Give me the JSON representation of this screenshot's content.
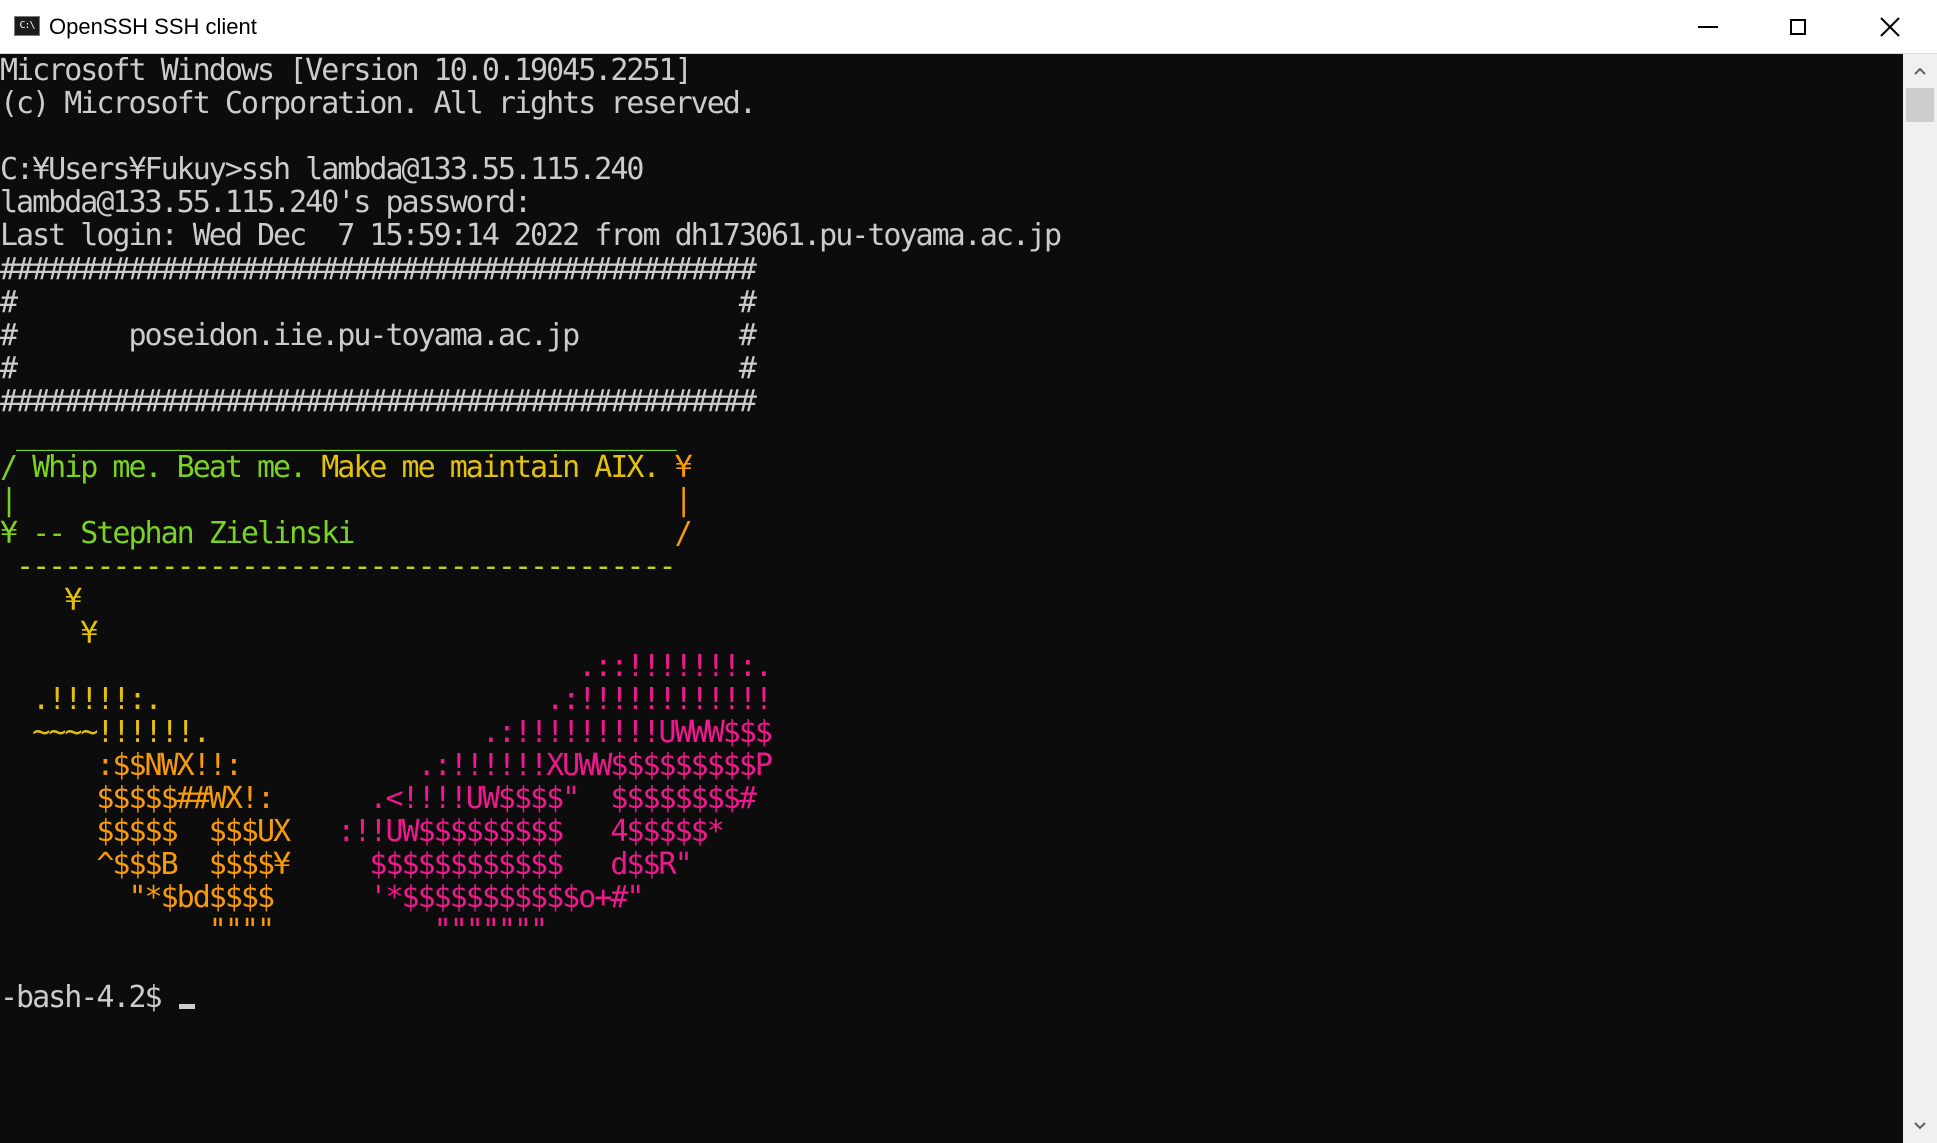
{
  "window": {
    "title": "OpenSSH SSH client",
    "icon_name": "console-app-icon",
    "icon_text": "C:\\",
    "controls": [
      "minimize",
      "maximize",
      "close"
    ]
  },
  "colors": {
    "background": "#0c0c0c",
    "text": "#cccccc",
    "green": "#7ad320",
    "yellowgreen": "#bcd616",
    "yellow": "#e4c20a",
    "orange": "#f79a0a",
    "darkorange": "#f7731a",
    "pink": "#f0188f",
    "magenta": "#ec1a8c"
  },
  "terminal": {
    "lines": [
      [
        {
          "t": "Microsoft Windows [Version 10.0.19045.2251]"
        }
      ],
      [
        {
          "t": "(c) Microsoft Corporation. All rights reserved."
        }
      ],
      [
        {
          "t": ""
        }
      ],
      [
        {
          "t": "C:¥Users¥Fukuy>ssh lambda@133.55.115.240"
        }
      ],
      [
        {
          "t": "lambda@133.55.115.240's password:"
        }
      ],
      [
        {
          "t": "Last login: Wed Dec  7 15:59:14 2022 from dh173061.pu-toyama.ac.jp"
        }
      ],
      [
        {
          "t": "###############################################"
        }
      ],
      [
        {
          "t": "#                                             #"
        }
      ],
      [
        {
          "t": "#       poseidon.iie.pu-toyama.ac.jp          #"
        }
      ],
      [
        {
          "t": "#                                             #"
        }
      ],
      [
        {
          "t": "###############################################"
        }
      ],
      [
        {
          "t": " _________________________________________",
          "c": "green"
        }
      ],
      [
        {
          "t": "/ Whip me. Beat me. ",
          "c": "green"
        },
        {
          "t": "Make me maintain AIX.",
          "c": "yellow"
        },
        {
          "t": " ¥",
          "c": "orange"
        }
      ],
      [
        {
          "t": "|",
          "c": "green"
        },
        {
          "t": "                                         |",
          "c": "orange"
        }
      ],
      [
        {
          "t": "¥ -- Stephan Zielinski",
          "c": "green"
        },
        {
          "t": "                    /",
          "c": "orange"
        }
      ],
      [
        {
          "t": " -----------------------------------------",
          "c": "yellowgreen"
        }
      ],
      [
        {
          "t": "    ¥",
          "c": "yellow"
        }
      ],
      [
        {
          "t": "     ¥",
          "c": "yellow"
        }
      ],
      [
        {
          "t": "                                    ",
          "c": "yellow"
        },
        {
          "t": ".::!!!!!!!:.",
          "c": "pink"
        }
      ],
      [
        {
          "t": "  .!!!!!:.",
          "c": "yellow"
        },
        {
          "t": "                        ",
          "c": "yellow"
        },
        {
          "t": ".:!!!!!!!!!!!!",
          "c": "pink"
        }
      ],
      [
        {
          "t": "  ~~~~!!!!!!.",
          "c": "yellow"
        },
        {
          "t": "                 ",
          "c": "yellow"
        },
        {
          "t": ".:!!!!!!!!!UWWW$$$",
          "c": "pink"
        }
      ],
      [
        {
          "t": "      :$$NWX!!:",
          "c": "orange"
        },
        {
          "t": "           ",
          "c": "orange"
        },
        {
          "t": ".:!!!!!!XUWW$$$$$$$$$P",
          "c": "pink"
        }
      ],
      [
        {
          "t": "      $$$$$##WX!:",
          "c": "orange"
        },
        {
          "t": "      ",
          "c": "orange"
        },
        {
          "t": ".<!!!!UW$$$$\"  $$$$$$$$#",
          "c": "pink"
        }
      ],
      [
        {
          "t": "      $$$$$  $$$UX",
          "c": "orange"
        },
        {
          "t": "   ",
          "c": "orange"
        },
        {
          "t": ":!!UW$$$$$$$$$   4$$$$$*",
          "c": "pink"
        }
      ],
      [
        {
          "t": "      ^$$$B  $$$$¥",
          "c": "orange"
        },
        {
          "t": "     ",
          "c": "orange"
        },
        {
          "t": "$$$$$$$$$$$$   d$$R\"",
          "c": "pink"
        }
      ],
      [
        {
          "t": "        \"*$bd$$$$",
          "c": "orange"
        },
        {
          "t": "      ",
          "c": "orange"
        },
        {
          "t": "'*$$$$$$$$$$$o+#\"",
          "c": "pink"
        }
      ],
      [
        {
          "t": "             \"\"\"\"",
          "c": "orange"
        },
        {
          "t": "          ",
          "c": "orange"
        },
        {
          "t": "\"\"\"\"\"\"\"",
          "c": "pink"
        }
      ],
      [
        {
          "t": ""
        }
      ],
      [
        {
          "t": "-bash-4.2$ "
        }
      ]
    ]
  },
  "scrollbar": {
    "up_icon": "scroll-up-arrow-icon",
    "down_icon": "scroll-down-arrow-icon"
  }
}
